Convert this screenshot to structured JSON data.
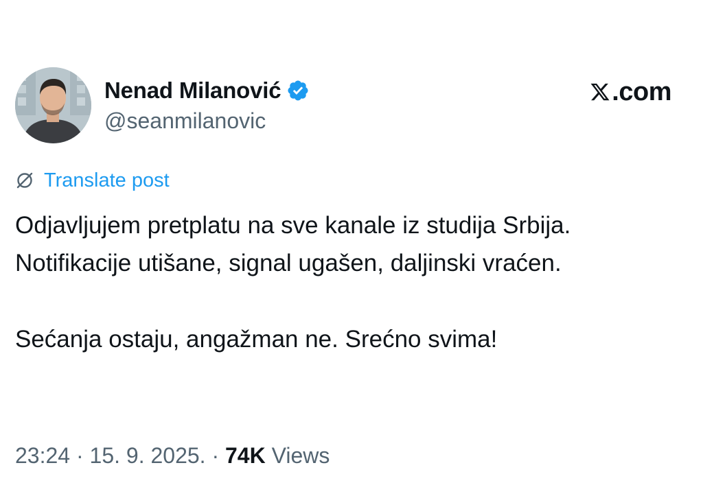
{
  "author": {
    "display_name": "Nenad Milanović",
    "handle": "@seanmilanovic",
    "verified_color": "#1d9bf0"
  },
  "brand": {
    "site": ".com",
    "logo_icon": "x-logo-icon"
  },
  "translate": {
    "label": "Translate post",
    "icon": "globe-icon",
    "color": "#1d9bf0"
  },
  "post": {
    "paragraph_1": "Odjavljujem pretplatu na sve kanale iz studija Srbija. Notifikacije utišane, signal ugašen, daljinski vraćen.",
    "paragraph_2": "Sećanja ostaju, angažman ne. Srećno svima!"
  },
  "meta": {
    "time": "23:24",
    "separator": " · ",
    "date": "15. 9. 2025.",
    "separator2": " · ",
    "views_count": "74K",
    "views_label": " Views"
  }
}
